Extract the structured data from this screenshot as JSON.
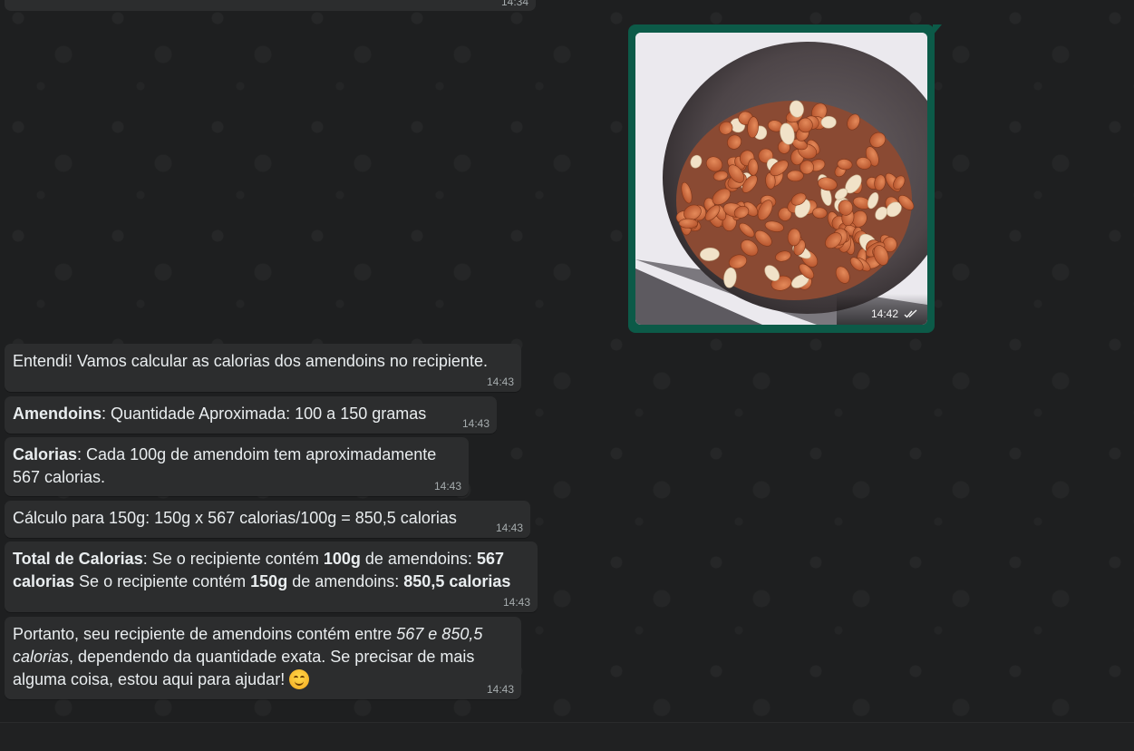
{
  "top_stub": {
    "time": "14:34"
  },
  "image_message": {
    "time": "14:42",
    "status_icon": "double-check-icon"
  },
  "messages": [
    {
      "time": "14:43",
      "parts": [
        {
          "t": "Entendi! Vamos calcular as calorias dos amendoins no recipiente."
        }
      ]
    },
    {
      "time": "14:43",
      "parts": [
        {
          "t": "Amendoins",
          "b": true
        },
        {
          "t": ": Quantidade Aproximada: 100 a 150 gramas"
        }
      ]
    },
    {
      "time": "14:43",
      "parts": [
        {
          "t": "Calorias",
          "b": true
        },
        {
          "t": ": Cada 100g de amendoim tem aproximadamente 567 calorias."
        }
      ]
    },
    {
      "time": "14:43",
      "parts": [
        {
          "t": "Cálculo para 150g: 150g x 567 calorias/100g = 850,5 calorias"
        }
      ]
    },
    {
      "time": "14:43",
      "parts": [
        {
          "t": "Total de Calorias",
          "b": true
        },
        {
          "t": ": Se o recipiente contém "
        },
        {
          "t": "100g",
          "b": true
        },
        {
          "t": " de amendoins: "
        },
        {
          "t": "567 calorias",
          "b": true
        },
        {
          "t": " Se o recipiente contém "
        },
        {
          "t": "150g",
          "b": true
        },
        {
          "t": " de amendoins: "
        },
        {
          "t": "850,5 calorias",
          "b": true
        }
      ]
    },
    {
      "time": "14:43",
      "parts": [
        {
          "t": "Portanto, seu recipiente de amendoins contém entre "
        },
        {
          "t": "567 e 850,5 calorias",
          "i": true
        },
        {
          "t": ", dependendo da quantidade exata. Se precisar de mais alguma coisa, estou aqui para ajudar! "
        },
        {
          "emoji": "smiling-face-icon"
        }
      ]
    }
  ],
  "colors": {
    "incoming_bubble": "#2c2d2e",
    "outgoing_bubble": "#0c5a48",
    "timestamp": "#a6acae",
    "read_ticks": "#f5f5f5"
  }
}
